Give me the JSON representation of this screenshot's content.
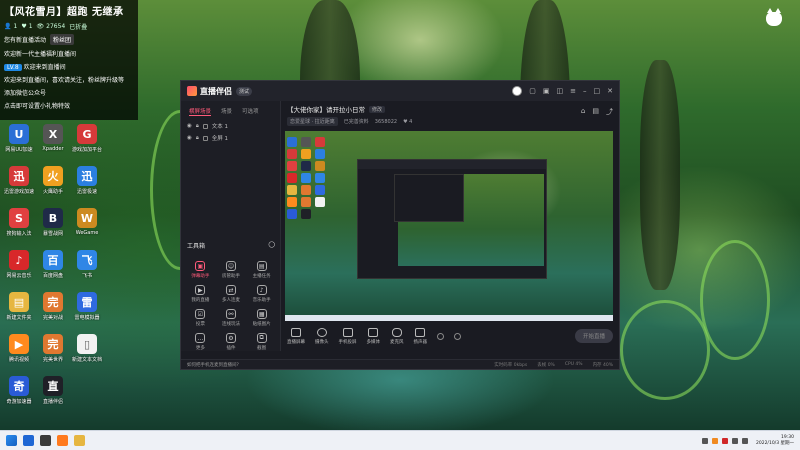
{
  "overlay": {
    "title": "【风花雪月】超跑 无继承",
    "stats": [
      "1",
      "1",
      "27654",
      "已折叠"
    ],
    "lines": [
      {
        "left": "您有新直播活动",
        "right": "粉丝团"
      },
      {
        "text": "欢迎新一代主播福利直播间"
      },
      {
        "text": "欢迎来到直播间",
        "badge": "LV.8"
      },
      {
        "text": "欢迎来到直播间，喜欢请关注，粉丝牌升级等"
      },
      {
        "text": "添加微信公众号"
      },
      {
        "text": "点击即可设置小礼物特效"
      }
    ]
  },
  "desktop_icons": [
    {
      "label": "网易UU加速",
      "color": "#2b6fd6",
      "glyph": "U"
    },
    {
      "label": "Xpadder",
      "color": "#555555",
      "glyph": "X"
    },
    {
      "label": "游戏加加平台",
      "color": "#d63a3a",
      "glyph": "G"
    },
    {
      "label": "迅雷游戏加速",
      "color": "#d63a3a",
      "glyph": "迅"
    },
    {
      "label": "火鹰助手",
      "color": "#f0a020",
      "glyph": "火"
    },
    {
      "label": "迅雷极速",
      "color": "#2b7fe0",
      "glyph": "迅"
    },
    {
      "label": "搜狗输入法",
      "color": "#e04040",
      "glyph": "S"
    },
    {
      "label": "暴雪战网",
      "color": "#1f2a48",
      "glyph": "B"
    },
    {
      "label": "WeGame",
      "color": "#cc8a20",
      "glyph": "W"
    },
    {
      "label": "网易云音乐",
      "color": "#d8282a",
      "glyph": "♪"
    },
    {
      "label": "百度网盘",
      "color": "#2f86e6",
      "glyph": "百"
    },
    {
      "label": "飞书",
      "color": "#2f86e6",
      "glyph": "飞"
    },
    {
      "label": "新建文件夹",
      "color": "#e6b640",
      "glyph": "▤"
    },
    {
      "label": "完美对战",
      "color": "#e07830",
      "glyph": "完"
    },
    {
      "label": "雷电模拟器",
      "color": "#2f6ae0",
      "glyph": "雷"
    },
    {
      "label": "腾讯视频",
      "color": "#ff8a1e",
      "glyph": "▶"
    },
    {
      "label": "完美世界",
      "color": "#e07830",
      "glyph": "完"
    },
    {
      "label": "新建文本文档",
      "color": "#f2f2f2",
      "glyph": "▯"
    },
    {
      "label": "奇游加速器",
      "color": "#2a5bd6",
      "glyph": "奇"
    },
    {
      "label": "直播伴侣",
      "color": "#1f2027",
      "glyph": "直"
    }
  ],
  "app": {
    "logo": "直播伴侣",
    "version": "测试",
    "scene_tabs": [
      "横屏场景",
      "场景",
      "可选项"
    ],
    "sources": [
      "文本 1",
      "全屏 1"
    ],
    "tools_header": "工具箱",
    "tools": [
      "弹幕助手",
      "房管助手",
      "主播任务",
      "我的直播",
      "多人连麦",
      "音乐助手",
      "投票",
      "连线玩法",
      "贴纸图片",
      "更多",
      "插件",
      "截图"
    ],
    "room_title": "【大佬你家】请开拉小日常",
    "room_edit": "修改",
    "room_meta": [
      "恋爱星球 · 拉近距离",
      "已完善资料",
      "3658022",
      "4"
    ],
    "controls": [
      "直播屏幕",
      "摄像头",
      "手机投屏",
      "多媒体",
      "麦克风",
      "扬声器"
    ],
    "start_live": "开始直播",
    "status_hint": "如何把手机连麦到直播间?",
    "status_stats": [
      "实时码率 0kbps",
      "丢帧 0%",
      "CPU 4%",
      "内存 40%"
    ]
  },
  "taskbar": {
    "time": "19:30",
    "date": "2022/10/3 星期一",
    "icons": [
      "#1f67d4",
      "#3a3a3a",
      "#ff7a1e",
      "#e6b640"
    ]
  }
}
